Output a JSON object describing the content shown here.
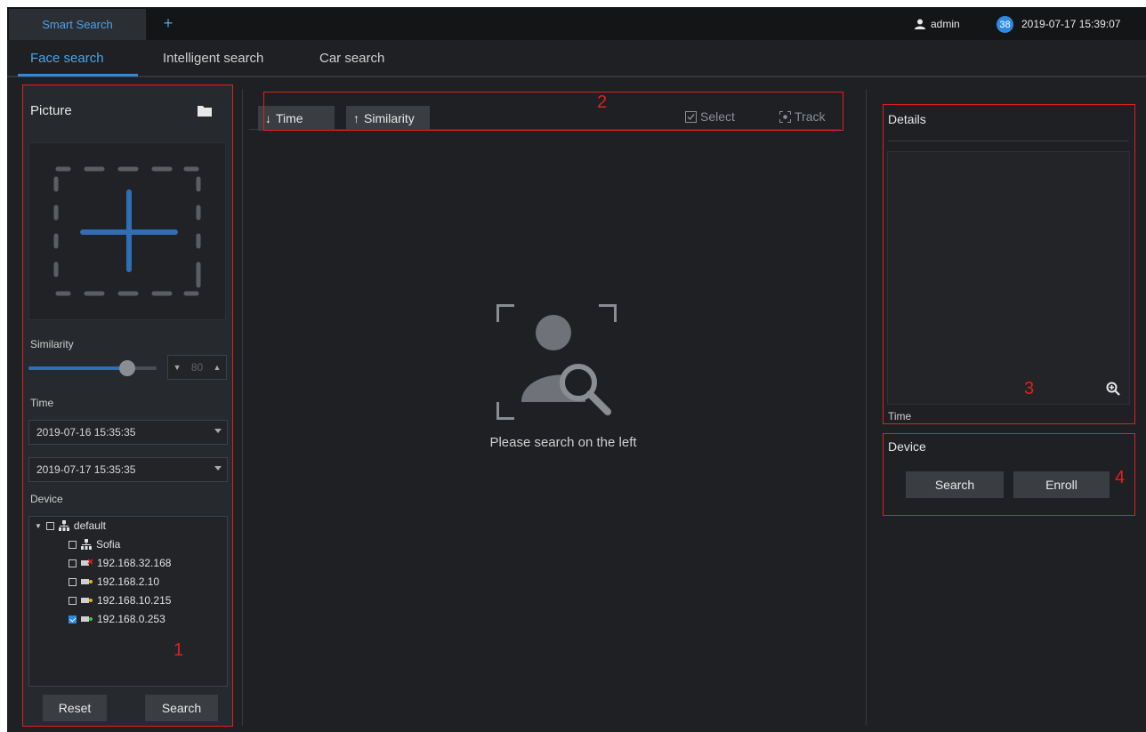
{
  "topbar": {
    "app_tab": "Smart Search",
    "add_tab": "+",
    "user": "admin",
    "badge_count": "38",
    "datetime": "2019-07-17 15:39:07"
  },
  "tabs": [
    {
      "label": "Face search",
      "active": true
    },
    {
      "label": "Intelligent search",
      "active": false
    },
    {
      "label": "Car search",
      "active": false
    }
  ],
  "left_panel": {
    "title": "Picture",
    "similarity_label": "Similarity",
    "similarity_value": "80",
    "similarity_level": 0.8,
    "time_label": "Time",
    "start_time": "2019-07-16 15:35:35",
    "end_time": "2019-07-17 15:35:35",
    "device_label": "Device",
    "tree": [
      {
        "label": "default",
        "checked": false
      },
      {
        "label": "Sofia",
        "checked": false
      },
      {
        "label": "192.168.32.168",
        "checked": false
      },
      {
        "label": "192.168.2.10",
        "checked": false
      },
      {
        "label": "192.168.10.215",
        "checked": false
      },
      {
        "label": "192.168.0.253",
        "checked": true
      }
    ],
    "reset_label": "Reset",
    "search_label": "Search"
  },
  "center": {
    "sort_time": "Time",
    "sort_similarity": "Similarity",
    "select_label": "Select",
    "track_label": "Track",
    "empty_message": "Please search on the left"
  },
  "right_panel": {
    "details_title": "Details",
    "time_label": "Time",
    "device_label": "Device",
    "search_label": "Search",
    "enroll_label": "Enroll"
  },
  "annotations": {
    "n1": "1",
    "n2": "2",
    "n3": "3",
    "n4": "4",
    "color": "#e02020"
  },
  "colors": {
    "accent": "#2f8be0",
    "background": "#1e2023"
  }
}
